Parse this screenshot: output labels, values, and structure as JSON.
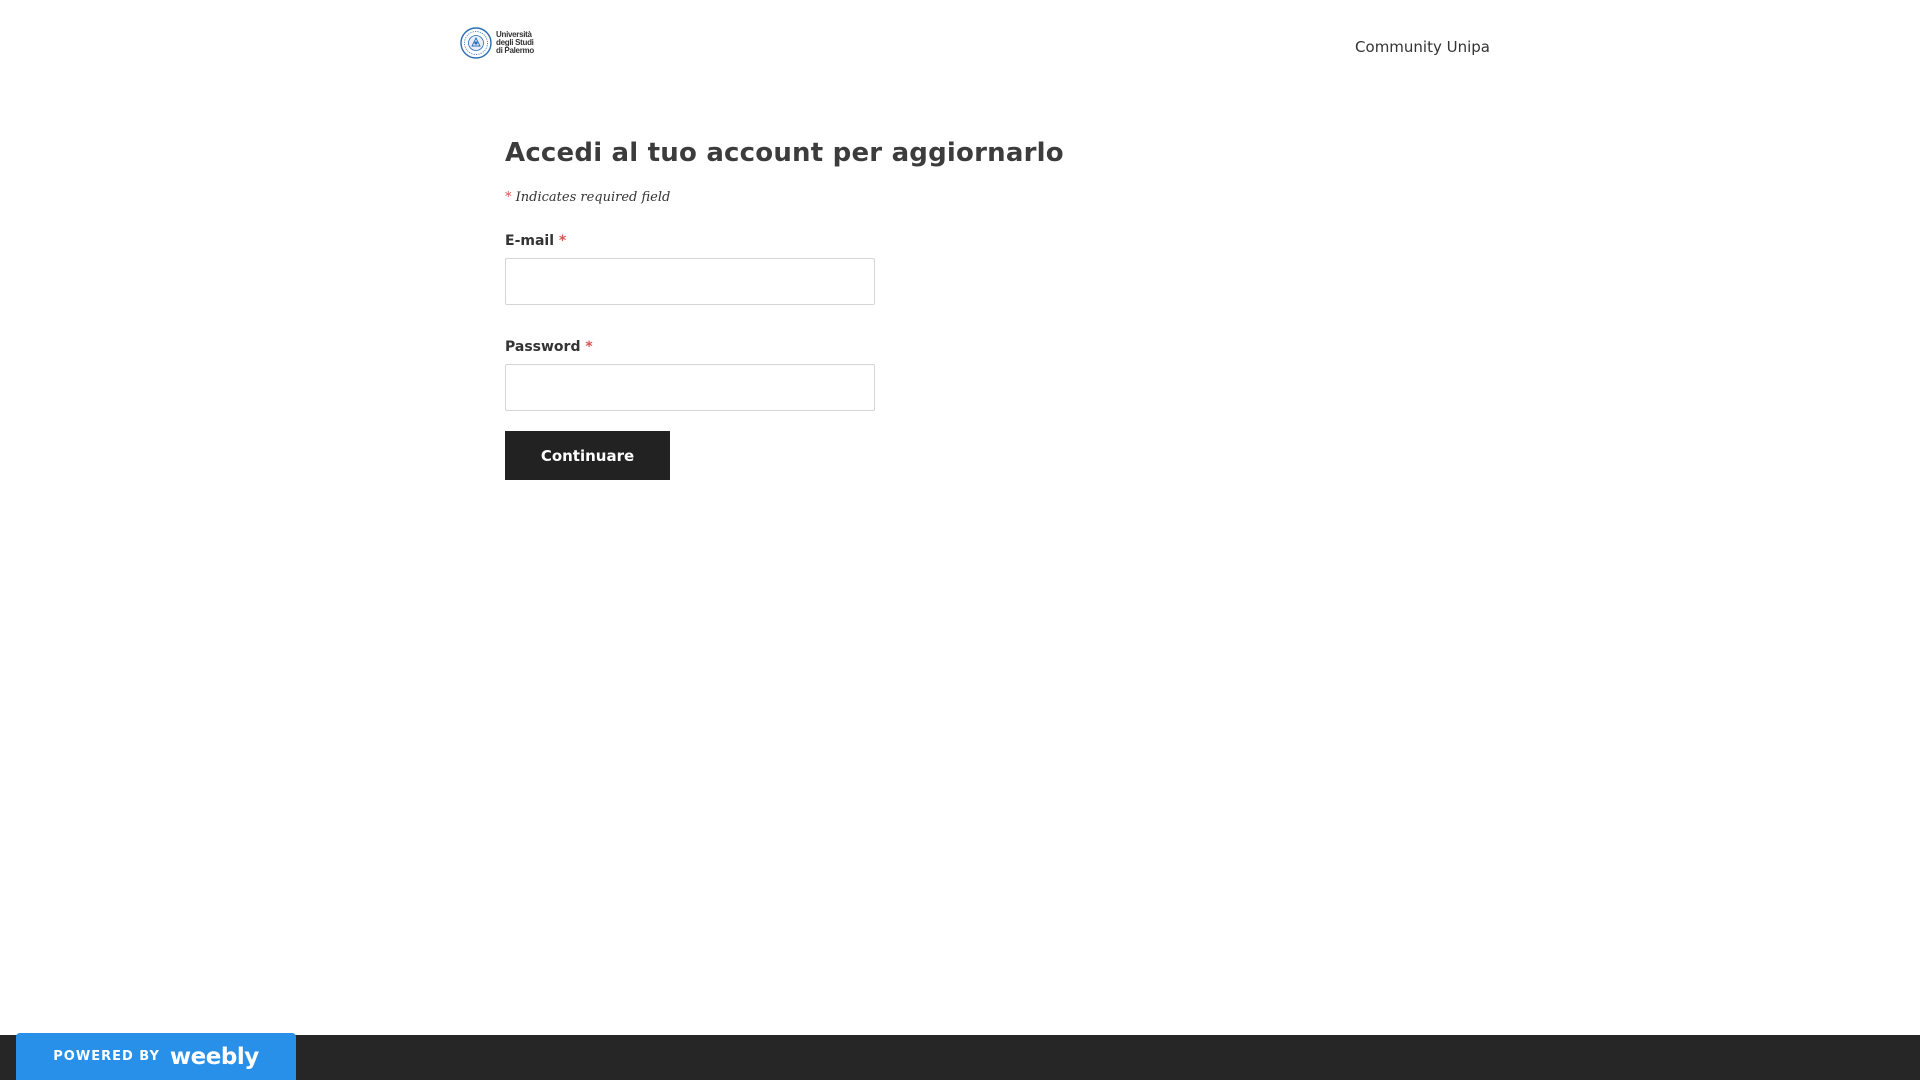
{
  "header": {
    "logo": {
      "icon": "university-seal-icon",
      "lines": [
        "Università",
        "degli Studi",
        "di Palermo"
      ],
      "seal_color": "#2a6db5"
    },
    "nav_link": "Community Unipa"
  },
  "form": {
    "title": "Accedi al tuo account per aggiornarlo",
    "required_marker": "*",
    "required_note": "Indicates required field",
    "email_label": "E-mail",
    "email_value": "",
    "password_label": "Password",
    "password_value": "",
    "submit_label": "Continuare"
  },
  "footer": {
    "powered_label": "POWERED BY",
    "brand": "weebly",
    "badge_color": "#2990ea",
    "bar_color": "#262626"
  },
  "colors": {
    "required": "#d9534f",
    "button": "#222222"
  }
}
